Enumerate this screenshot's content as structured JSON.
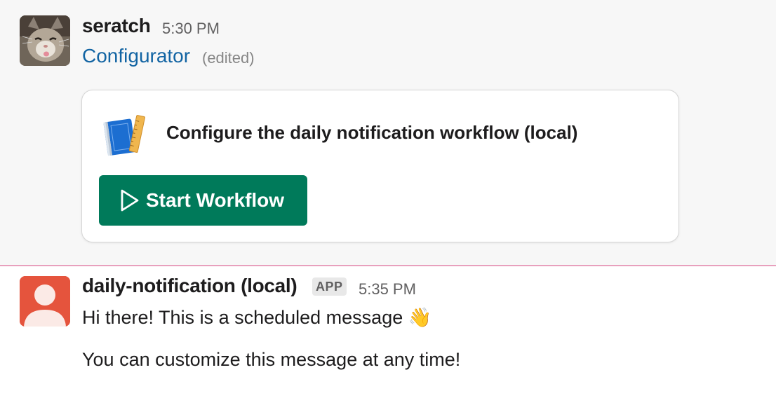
{
  "messages": [
    {
      "sender": "seratch",
      "time": "5:30 PM",
      "app_name": "Configurator",
      "edited_label": "(edited)",
      "card": {
        "title": "Configure the daily notification workflow (local)",
        "icon": "blueprint-ruler-icon",
        "button_label": "Start Workflow",
        "button_icon": "play-icon",
        "button_color": "#007a5a"
      }
    },
    {
      "sender": "daily-notification (local)",
      "badge": "APP",
      "time": "5:35 PM",
      "line1": "Hi there! This is a scheduled message",
      "emoji": "👋",
      "line2": "You can customize this message at any time!"
    }
  ],
  "colors": {
    "link": "#1264a3",
    "unread_divider": "#e8a0bd",
    "bot_avatar": "#e5543d",
    "highlight_bg": "#f7f7f7"
  }
}
